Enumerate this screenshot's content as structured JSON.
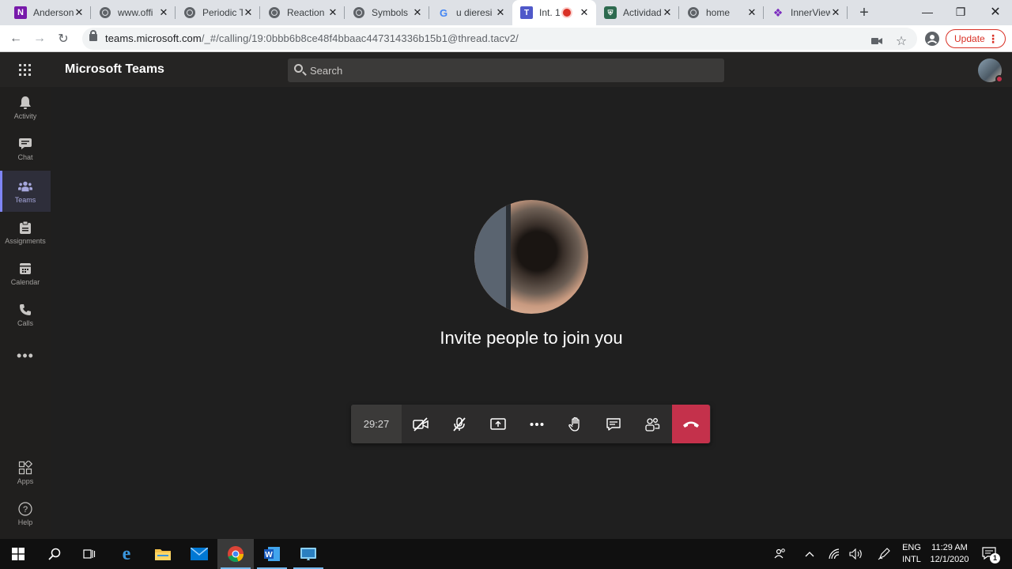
{
  "browser": {
    "tabs": [
      {
        "title": "Anderson",
        "icon": "onenote-icon",
        "color": "#7719aa"
      },
      {
        "title": "www.offi",
        "icon": "globe-icon"
      },
      {
        "title": "Periodic T",
        "icon": "globe-icon"
      },
      {
        "title": "Reaction",
        "icon": "globe-icon"
      },
      {
        "title": "Symbols",
        "icon": "globe-icon"
      },
      {
        "title": "u dieresi",
        "icon": "google-icon"
      },
      {
        "title": "Int. 1",
        "icon": "teams-icon",
        "active": true,
        "recording": true
      },
      {
        "title": "Actividad",
        "icon": "shield-icon"
      },
      {
        "title": "home",
        "icon": "globe-icon"
      },
      {
        "title": "InnerView",
        "icon": "innerview-icon"
      }
    ],
    "new_tab_label": "+",
    "url_host": "teams.microsoft.com",
    "url_path": "/_#/calling/19:0bbb6b8ce48f4bbaac447314336b15b1@thread.tacv2/",
    "update_label": "Update"
  },
  "teams": {
    "brand": "Microsoft Teams",
    "search_placeholder": "Search",
    "rail": [
      {
        "label": "Activity",
        "icon": "bell-icon"
      },
      {
        "label": "Chat",
        "icon": "chat-icon"
      },
      {
        "label": "Teams",
        "icon": "teams-icon",
        "active": true
      },
      {
        "label": "Assignments",
        "icon": "assignments-icon"
      },
      {
        "label": "Calendar",
        "icon": "calendar-icon"
      },
      {
        "label": "Calls",
        "icon": "phone-icon"
      },
      {
        "label": "",
        "icon": "more-icon"
      }
    ],
    "rail_bottom": [
      {
        "label": "Apps",
        "icon": "apps-icon"
      },
      {
        "label": "Help",
        "icon": "help-icon"
      }
    ],
    "call": {
      "invite_text": "Invite people to join you",
      "timer": "29:27",
      "accent": "#c4314b"
    }
  },
  "taskbar": {
    "language_line1": "ENG",
    "language_line2": "INTL",
    "time": "11:29 AM",
    "date": "12/1/2020",
    "notification_count": "1"
  }
}
